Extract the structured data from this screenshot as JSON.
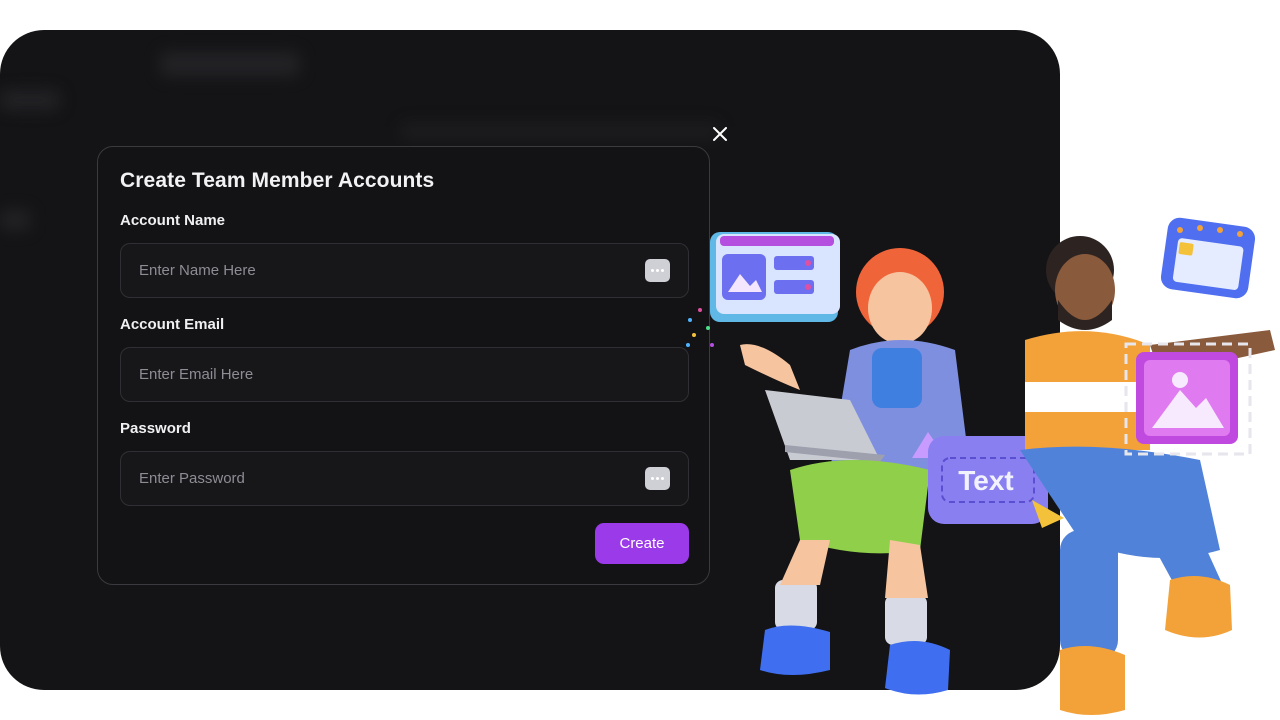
{
  "modal": {
    "title": "Create Team Member Accounts",
    "fields": [
      {
        "label": "Account Name",
        "placeholder": "Enter Name Here",
        "has_action": true
      },
      {
        "label": "Account Email",
        "placeholder": "Enter Email Here",
        "has_action": false
      },
      {
        "label": "Password",
        "placeholder": "Enter Password",
        "has_action": true
      }
    ],
    "create_label": "Create",
    "close_icon": "close-icon"
  },
  "illustration": {
    "badge_text": "Text",
    "icons": [
      "image-window-icon",
      "calendar-icon",
      "image-frame-icon"
    ]
  },
  "colors": {
    "background": "#141416",
    "modal_border": "#3a3a3f",
    "accent": "#9b3ae8",
    "text": "#f2f2f4",
    "placeholder": "#8d8d93"
  }
}
